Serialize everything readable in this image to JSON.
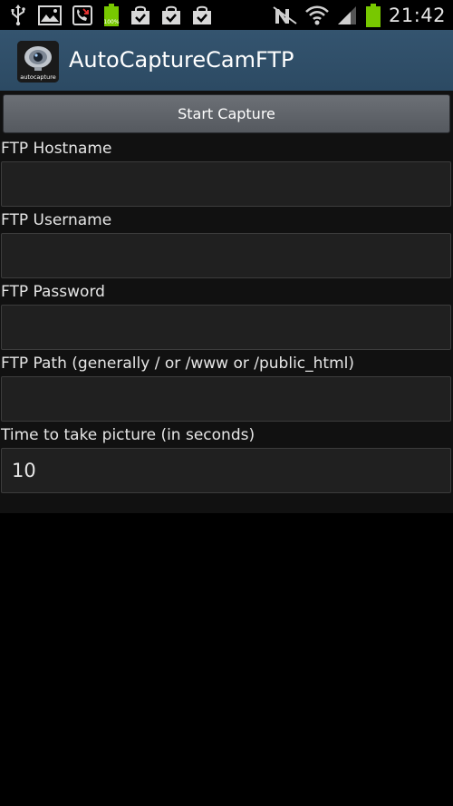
{
  "status_bar": {
    "time": "21:42",
    "battery_level_percent": 100,
    "left_icons": [
      "usb-icon",
      "gallery-icon",
      "missed-call-icon",
      "battery-full-icon",
      "shopping-bag-check-icon",
      "shopping-bag-check-icon",
      "shopping-bag-check-icon"
    ],
    "right_icons": [
      "mute-icon",
      "wifi-icon",
      "signal-icon",
      "battery-icon"
    ]
  },
  "action_bar": {
    "title": "AutoCaptureCamFTP",
    "icon_label": "autocapture",
    "background_color": "#2f4e68"
  },
  "start_button": {
    "label": "Start Capture"
  },
  "fields": [
    {
      "label": "FTP Hostname",
      "value": ""
    },
    {
      "label": "FTP Username",
      "value": ""
    },
    {
      "label": "FTP Password",
      "value": ""
    },
    {
      "label": "FTP Path (generally / or /www or /public_html)",
      "value": ""
    },
    {
      "label": "Time to take picture (in seconds)",
      "value": "10"
    }
  ]
}
